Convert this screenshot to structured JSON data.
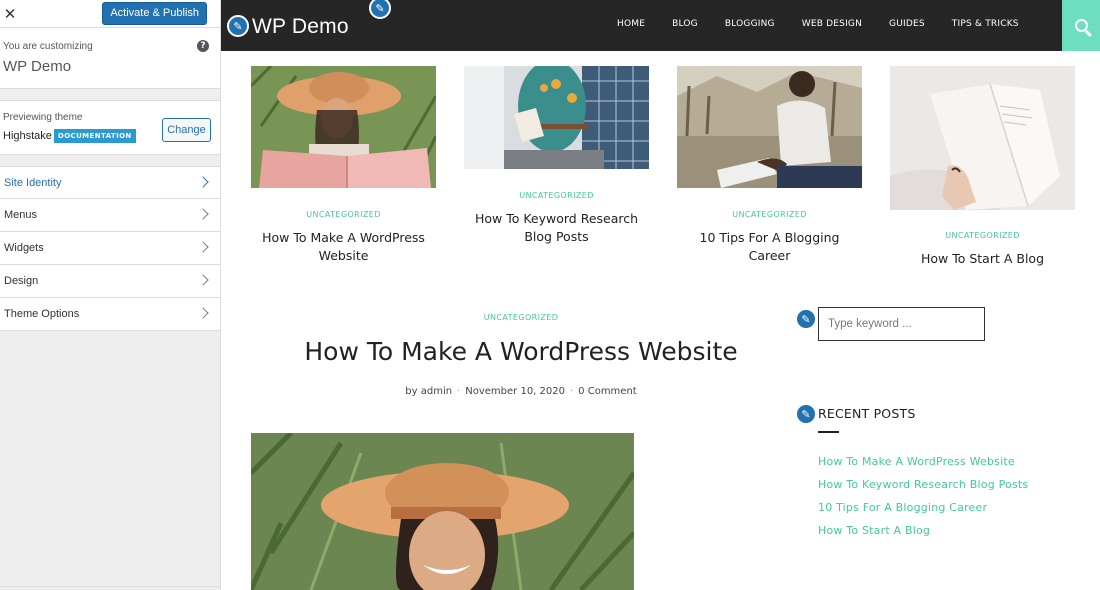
{
  "customizer": {
    "publish_label": "Activate & Publish",
    "close_glyph": "✕",
    "customizing_label": "You are customizing",
    "site_title": "WP Demo",
    "help_glyph": "?",
    "previewing_label": "Previewing theme",
    "theme_name": "Highstake",
    "documentation_badge": "DOCUMENTATION",
    "change_label": "Change",
    "sections": [
      {
        "label": "Site Identity"
      },
      {
        "label": "Menus"
      },
      {
        "label": "Widgets"
      },
      {
        "label": "Design"
      },
      {
        "label": "Theme Options"
      }
    ]
  },
  "site": {
    "logo": "WP Demo",
    "nav": [
      "HOME",
      "BLOG",
      "BLOGGING",
      "WEB DESIGN",
      "GUIDES",
      "TIPS & TRICKS"
    ],
    "edit_glyph": "✎"
  },
  "posts": [
    {
      "category": "UNCATEGORIZED",
      "title_line1": "How To Make A WordPress",
      "title_line2": "Website"
    },
    {
      "category": "UNCATEGORIZED",
      "title_line1": "How To Keyword Research",
      "title_line2": "Blog Posts"
    },
    {
      "category": "UNCATEGORIZED",
      "title_line1": "10 Tips For A Blogging",
      "title_line2": "Career"
    },
    {
      "category": "UNCATEGORIZED",
      "title_line1": "How To Start A Blog",
      "title_line2": ""
    }
  ],
  "article": {
    "category": "UNCATEGORIZED",
    "title": "How To Make A WordPress Website",
    "author": "by admin",
    "date": "November 10, 2020",
    "comments": "0 Comment",
    "separator": "·"
  },
  "widgets": {
    "search_placeholder": "Type keyword ...",
    "recent_posts_title": "RECENT POSTS",
    "recent_posts": [
      "How To Make A WordPress Website",
      "How To Keyword Research Blog Posts",
      "10 Tips For A Blogging Career",
      "How To Start A Blog"
    ]
  },
  "colors": {
    "accent_teal": "#41c99c",
    "search_button": "#6ddfc0",
    "header_bg": "#262626",
    "wp_blue": "#2271b1"
  }
}
